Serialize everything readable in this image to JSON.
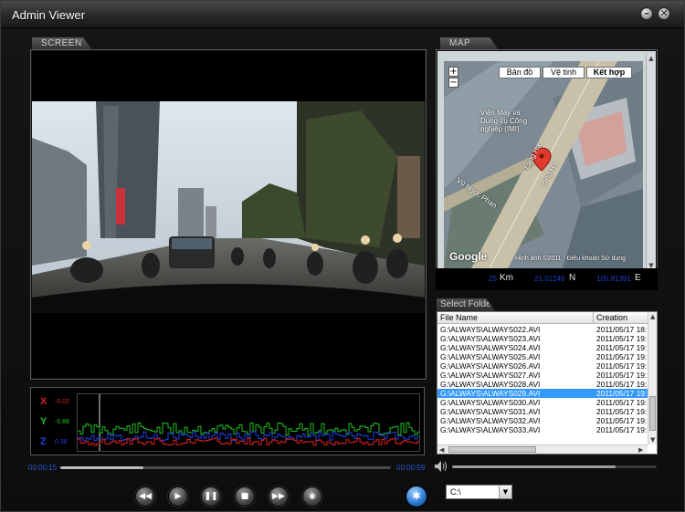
{
  "window": {
    "title": "Admin Viewer",
    "minimize_glyph": "–",
    "close_glyph": "✕"
  },
  "screen": {
    "tab_label": "SCREEN"
  },
  "map": {
    "tab_label": "MAP",
    "type_buttons": [
      "Bản đồ",
      "Vệ tinh",
      "Kết hợp"
    ],
    "active_type": "Kết hợp",
    "zoom_in": "+",
    "zoom_out": "−",
    "labels": {
      "poi": "Viện Máy và\nDụng cụ Công\nnghiệp (IMI)",
      "street1": "Láng Hạ",
      "street2": "Láng Hạ",
      "street3": "Vũ Ngọc Phan"
    },
    "logo": "Google",
    "copyright": "Hình ảnh ©2011 - Điều khoản Sử dụng"
  },
  "coords": {
    "km_value": "25",
    "km_unit": "Km",
    "lat_value": "21.01249",
    "lat_unit": "N",
    "lon_value": "105.81391",
    "lon_unit": "E"
  },
  "folder": {
    "label": "Select Folder",
    "columns": [
      "File Name",
      "Creation"
    ],
    "selected_index": 7,
    "rows": [
      {
        "name": "G:\\ALWAYS\\ALWAYS022.AVI",
        "created": "2011/05/17 18:"
      },
      {
        "name": "G:\\ALWAYS\\ALWAYS023.AVI",
        "created": "2011/05/17 19:"
      },
      {
        "name": "G:\\ALWAYS\\ALWAYS024.AVI",
        "created": "2011/05/17 19:"
      },
      {
        "name": "G:\\ALWAYS\\ALWAYS025.AVI",
        "created": "2011/05/17 19:"
      },
      {
        "name": "G:\\ALWAYS\\ALWAYS026.AVI",
        "created": "2011/05/17 19:"
      },
      {
        "name": "G:\\ALWAYS\\ALWAYS027.AVI",
        "created": "2011/05/17 19:"
      },
      {
        "name": "G:\\ALWAYS\\ALWAYS028.AVI",
        "created": "2011/05/17 19:"
      },
      {
        "name": "G:\\ALWAYS\\ALWAYS029.AVI",
        "created": "2011/05/17 19:"
      },
      {
        "name": "G:\\ALWAYS\\ALWAYS030.AVI",
        "created": "2011/05/17 19:"
      },
      {
        "name": "G:\\ALWAYS\\ALWAYS031.AVI",
        "created": "2011/05/17 19:"
      },
      {
        "name": "G:\\ALWAYS\\ALWAYS032.AVI",
        "created": "2011/05/17 19:"
      },
      {
        "name": "G:\\ALWAYS\\ALWAYS033.AVI",
        "created": "2011/05/17 19:"
      }
    ]
  },
  "gsensor": {
    "x_label": "X",
    "x_value": "-0.02",
    "x_color": "#e02020",
    "y_label": "Y",
    "y_value": "-0.88",
    "y_color": "#20c020",
    "z_label": "Z",
    "z_value": "0.36",
    "z_color": "#2040e0"
  },
  "playback": {
    "time_start": "00:00:15",
    "time_end": "00:00:59",
    "progress_fraction": 0.25,
    "volume_fraction": 0.8,
    "controls": [
      {
        "name": "rewind-button",
        "glyph": "◀◀"
      },
      {
        "name": "play-button",
        "glyph": "▶"
      },
      {
        "name": "pause-button",
        "glyph": "❚❚"
      },
      {
        "name": "stop-button",
        "glyph": "■"
      },
      {
        "name": "fast-forward-button",
        "glyph": "▶▶"
      },
      {
        "name": "snapshot-button",
        "glyph": "◉"
      }
    ],
    "capture_glyph": "✱"
  },
  "drive": {
    "selected": "C:\\",
    "dropdown_glyph": "▼"
  }
}
